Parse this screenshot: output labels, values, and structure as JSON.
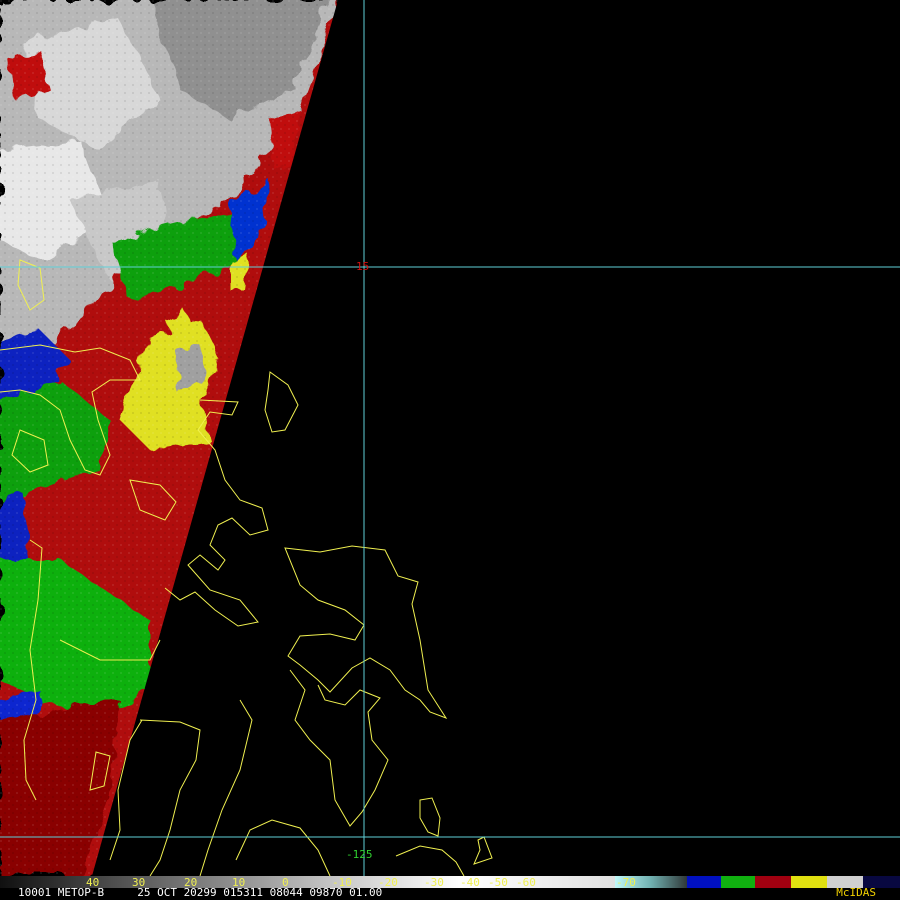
{
  "image": {
    "lat_label": "15",
    "lon_label": "-125",
    "colors": {
      "grid": "#5fd0d8",
      "coast": "#f0f050",
      "lat_label": "#d01010",
      "lon_label": "#30d030",
      "scale_text": "#f0f050"
    }
  },
  "colorbar": {
    "ticks": [
      "40",
      "30",
      "20",
      "10",
      "0",
      "-10",
      "-20",
      "-30",
      "-40",
      "-50",
      "-60",
      "-70"
    ]
  },
  "status": {
    "info": "10001 METOP-B     25 OCT 20299 015311 08044 09870 01.00",
    "brand": "McIDAS"
  }
}
